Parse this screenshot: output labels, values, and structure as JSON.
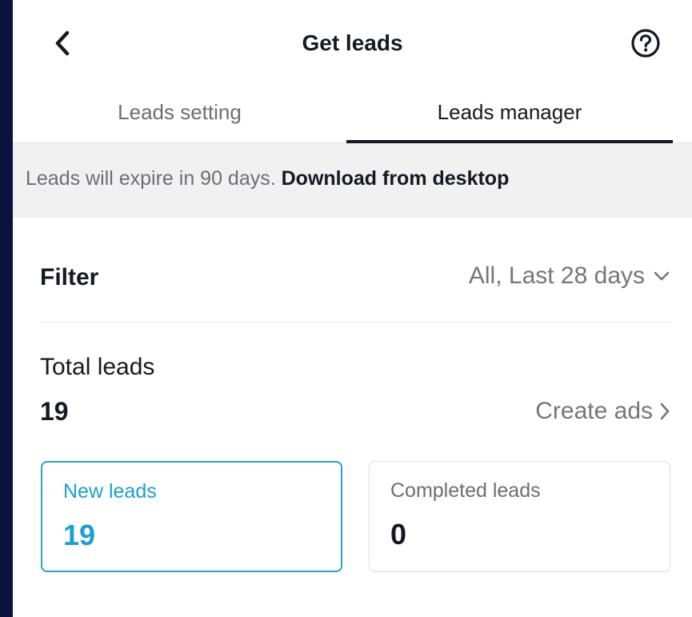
{
  "header": {
    "title": "Get leads",
    "back_icon": "chevron-left-icon",
    "help_icon": "question-circle-icon"
  },
  "tabs": [
    {
      "label": "Leads setting",
      "active": false
    },
    {
      "label": "Leads manager",
      "active": true
    }
  ],
  "notice": {
    "text": "Leads will expire in 90 days.",
    "link": "Download from desktop"
  },
  "filter": {
    "label": "Filter",
    "value": "All, Last 28 days",
    "icon": "chevron-down-icon"
  },
  "summary": {
    "total_label": "Total leads",
    "total_value": "19",
    "create_ads_label": "Create ads",
    "create_ads_icon": "chevron-right-icon"
  },
  "cards": [
    {
      "label": "New leads",
      "value": "19",
      "selected": true
    },
    {
      "label": "Completed leads",
      "value": "0",
      "selected": false
    }
  ],
  "colors": {
    "accent": "#1c9fcd",
    "text_primary": "#161823",
    "text_secondary": "#6c6e74",
    "background_outer": "#0a1240",
    "notice_bg": "#f1f1f2"
  }
}
